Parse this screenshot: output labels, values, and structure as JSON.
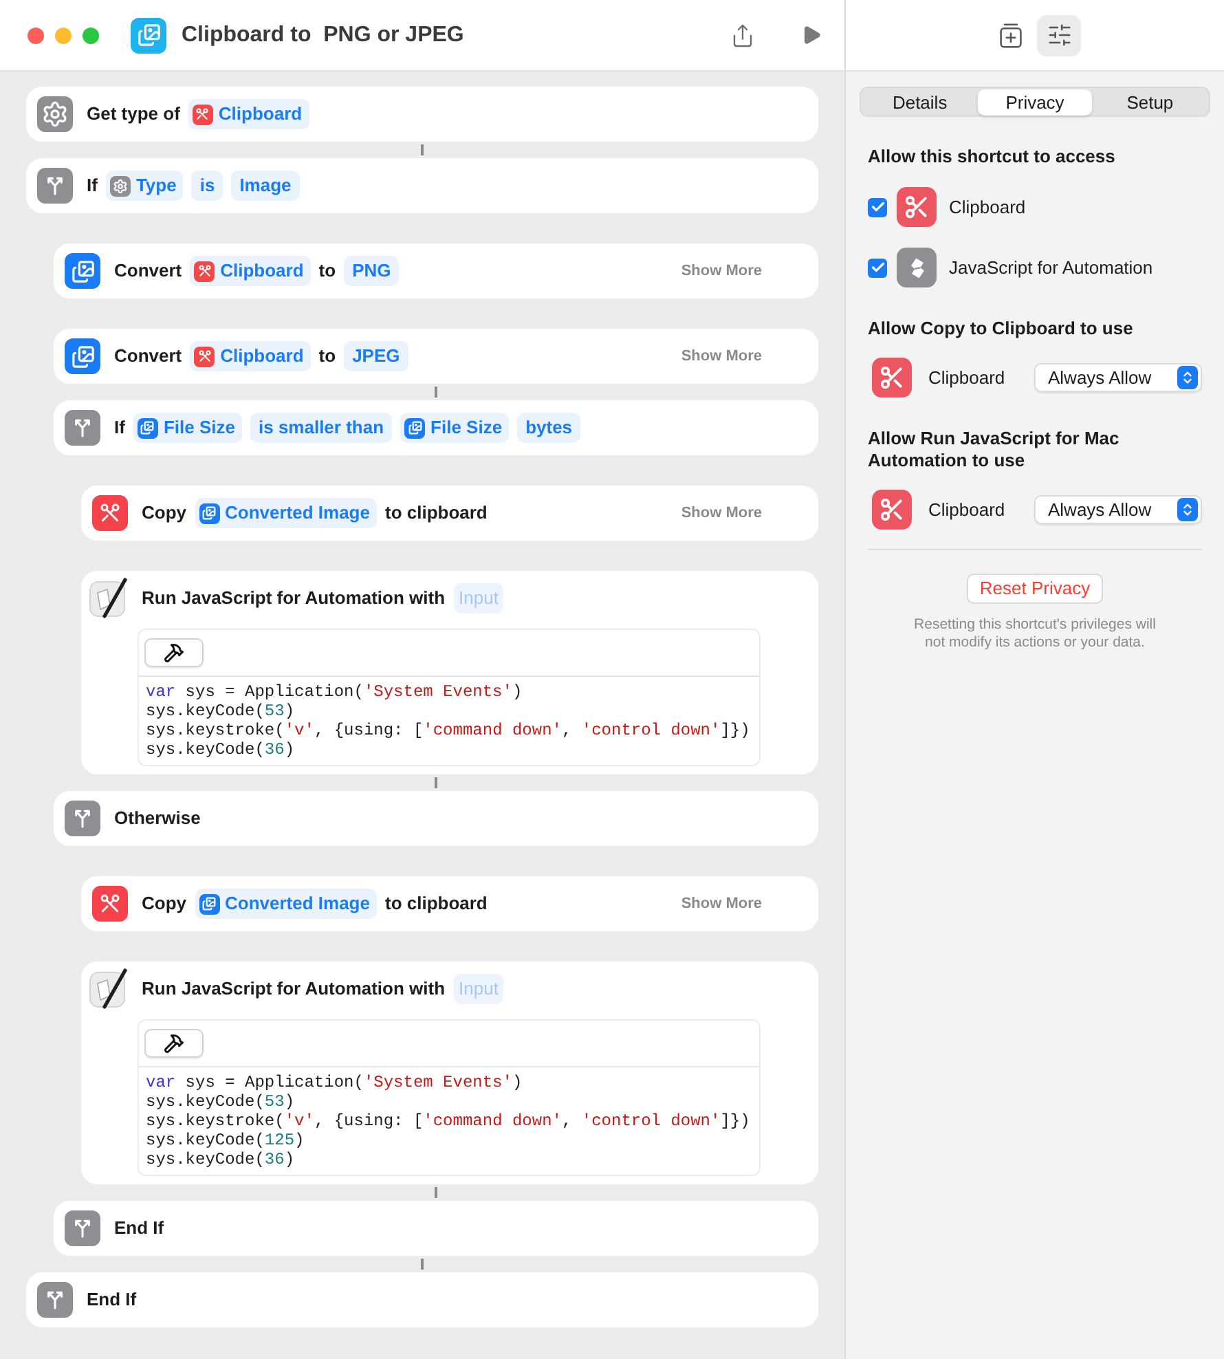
{
  "window": {
    "title": "Clipboard to  PNG or JPEG"
  },
  "actions": [
    {
      "kind": "get-type",
      "joined": false,
      "parts": [
        {
          "kind": "text",
          "text": "Get type of"
        },
        {
          "kind": "clipboard",
          "text": "Clipboard"
        }
      ]
    },
    {
      "kind": "branch",
      "joined": true,
      "parts": [
        {
          "kind": "text",
          "text": "If"
        },
        {
          "kind": "type",
          "text": "Type"
        },
        {
          "kind": "value",
          "text": "is"
        },
        {
          "kind": "value",
          "text": "Image"
        }
      ],
      "children": [
        {
          "kind": "convert",
          "joined": false,
          "parts": [
            {
              "kind": "text",
              "text": "Convert"
            },
            {
              "kind": "clipboard",
              "text": "Clipboard"
            },
            {
              "kind": "text",
              "text": "to"
            },
            {
              "kind": "value",
              "text": "PNG"
            }
          ],
          "show_more": "Show More"
        },
        {
          "kind": "convert",
          "joined": false,
          "parts": [
            {
              "kind": "text",
              "text": "Convert"
            },
            {
              "kind": "clipboard",
              "text": "Clipboard"
            },
            {
              "kind": "text",
              "text": "to"
            },
            {
              "kind": "value",
              "text": "JPEG"
            }
          ],
          "show_more": "Show More"
        },
        {
          "kind": "branch",
          "joined": true,
          "parts": [
            {
              "kind": "text",
              "text": "If"
            },
            {
              "kind": "image",
              "text": "File Size"
            },
            {
              "kind": "value",
              "text": "is smaller than"
            },
            {
              "kind": "image",
              "text": "File Size"
            },
            {
              "kind": "value",
              "text": "bytes"
            }
          ],
          "children": [
            {
              "kind": "copy",
              "joined": false,
              "parts": [
                {
                  "kind": "text",
                  "text": "Copy"
                },
                {
                  "kind": "image",
                  "text": "Converted Image"
                },
                {
                  "kind": "text",
                  "text": "to clipboard"
                }
              ],
              "show_more": "Show More"
            },
            {
              "kind": "script",
              "joined": false,
              "parts": [
                {
                  "kind": "text",
                  "text": "Run JavaScript for Automation with"
                },
                {
                  "kind": "input",
                  "text": "Input"
                }
              ],
              "code": [
                [
                  {
                    "kind": "keyword",
                    "text": "var"
                  },
                  {
                    "kind": "plain",
                    "text": " sys = Application("
                  },
                  {
                    "kind": "string",
                    "text": "'System Events'"
                  },
                  {
                    "kind": "plain",
                    "text": ")"
                  }
                ],
                [
                  {
                    "kind": "plain",
                    "text": "sys.keyCode("
                  },
                  {
                    "kind": "number",
                    "text": "53"
                  },
                  {
                    "kind": "plain",
                    "text": ")"
                  }
                ],
                [
                  {
                    "kind": "plain",
                    "text": "sys.keystroke("
                  },
                  {
                    "kind": "string",
                    "text": "'v'"
                  },
                  {
                    "kind": "plain",
                    "text": ", {using: ["
                  },
                  {
                    "kind": "string",
                    "text": "'command down'"
                  },
                  {
                    "kind": "plain",
                    "text": ", "
                  },
                  {
                    "kind": "string",
                    "text": "'control down'"
                  },
                  {
                    "kind": "plain",
                    "text": "]})"
                  }
                ],
                [
                  {
                    "kind": "plain",
                    "text": "sys.keyCode("
                  },
                  {
                    "kind": "number",
                    "text": "36"
                  },
                  {
                    "kind": "plain",
                    "text": ")"
                  }
                ]
              ]
            }
          ]
        },
        {
          "kind": "branch",
          "joined": true,
          "parts": [
            {
              "kind": "text",
              "text": "Otherwise"
            }
          ],
          "children": [
            {
              "kind": "copy",
              "joined": false,
              "parts": [
                {
                  "kind": "text",
                  "text": "Copy"
                },
                {
                  "kind": "image",
                  "text": "Converted Image"
                },
                {
                  "kind": "text",
                  "text": "to clipboard"
                }
              ],
              "show_more": "Show More"
            },
            {
              "kind": "script",
              "joined": false,
              "parts": [
                {
                  "kind": "text",
                  "text": "Run JavaScript for Automation with"
                },
                {
                  "kind": "input",
                  "text": "Input"
                }
              ],
              "code": [
                [
                  {
                    "kind": "keyword",
                    "text": "var"
                  },
                  {
                    "kind": "plain",
                    "text": " sys = Application("
                  },
                  {
                    "kind": "string",
                    "text": "'System Events'"
                  },
                  {
                    "kind": "plain",
                    "text": ")"
                  }
                ],
                [
                  {
                    "kind": "plain",
                    "text": "sys.keyCode("
                  },
                  {
                    "kind": "number",
                    "text": "53"
                  },
                  {
                    "kind": "plain",
                    "text": ")"
                  }
                ],
                [
                  {
                    "kind": "plain",
                    "text": "sys.keystroke("
                  },
                  {
                    "kind": "string",
                    "text": "'v'"
                  },
                  {
                    "kind": "plain",
                    "text": ", {using: ["
                  },
                  {
                    "kind": "string",
                    "text": "'command down'"
                  },
                  {
                    "kind": "plain",
                    "text": ", "
                  },
                  {
                    "kind": "string",
                    "text": "'control down'"
                  },
                  {
                    "kind": "plain",
                    "text": "]})"
                  }
                ],
                [
                  {
                    "kind": "plain",
                    "text": "sys.keyCode("
                  },
                  {
                    "kind": "number",
                    "text": "125"
                  },
                  {
                    "kind": "plain",
                    "text": ")"
                  }
                ],
                [
                  {
                    "kind": "plain",
                    "text": "sys.keyCode("
                  },
                  {
                    "kind": "number",
                    "text": "36"
                  },
                  {
                    "kind": "plain",
                    "text": ")"
                  }
                ]
              ]
            }
          ]
        },
        {
          "kind": "branch",
          "joined": true,
          "parts": [
            {
              "kind": "text",
              "text": "End If"
            }
          ]
        }
      ]
    },
    {
      "kind": "branch",
      "joined": true,
      "parts": [
        {
          "kind": "text",
          "text": "End If"
        }
      ]
    }
  ],
  "inspector": {
    "toolbar": [
      {
        "kind": "add",
        "selected": false
      },
      {
        "kind": "settings",
        "selected": true
      }
    ],
    "tabs": [
      {
        "label": "Details",
        "selected": false
      },
      {
        "label": "Privacy",
        "selected": true
      },
      {
        "label": "Setup",
        "selected": false
      }
    ],
    "access": {
      "heading": "Allow this shortcut to access",
      "items": [
        {
          "kind": "clipboard",
          "label": "Clipboard",
          "checked": true
        },
        {
          "kind": "script",
          "label": "JavaScript for Automation",
          "checked": true
        }
      ]
    },
    "permissions": [
      {
        "heading": "Allow Copy to Clipboard to use",
        "rows": [
          {
            "kind": "clipboard",
            "label": "Clipboard",
            "value": "Always Allow"
          }
        ]
      },
      {
        "heading": "Allow Run JavaScript for Mac Automation to use",
        "rows": [
          {
            "kind": "clipboard",
            "label": "Clipboard",
            "value": "Always Allow"
          }
        ]
      }
    ],
    "reset_button": "Reset Privacy",
    "note": "Resetting this shortcut's privileges will not modify its actions or your data."
  }
}
